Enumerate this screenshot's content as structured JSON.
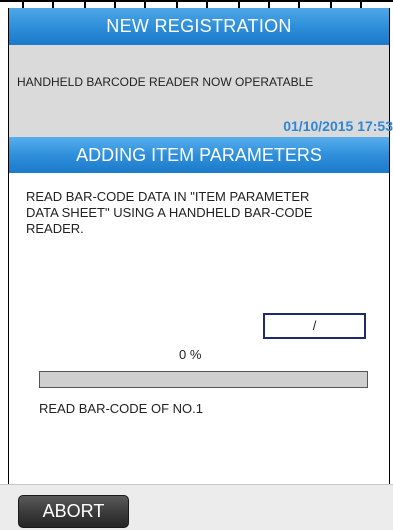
{
  "header": {
    "title": "NEW REGISTRATION"
  },
  "info": {
    "message": "HANDHELD BARCODE READER NOW OPERATABLE",
    "datetime": "01/10/2015 17:53"
  },
  "section": {
    "title": "ADDING ITEM PARAMETERS"
  },
  "instruction": {
    "text": "READ BAR-CODE DATA IN \"ITEM PARAMETER DATA SHEET\" USING A HANDHELD BAR-CODE READER."
  },
  "count": {
    "display": "/"
  },
  "progress": {
    "label": "0 %",
    "value": 0
  },
  "status": {
    "text": "READ BAR-CODE OF NO.1"
  },
  "footer": {
    "abort_label": "ABORT"
  },
  "colors": {
    "header_blue": "#2f8fdb",
    "datetime_blue": "#2f86d6",
    "info_gray": "#dadada",
    "button_dark": "#3a3a3a"
  }
}
